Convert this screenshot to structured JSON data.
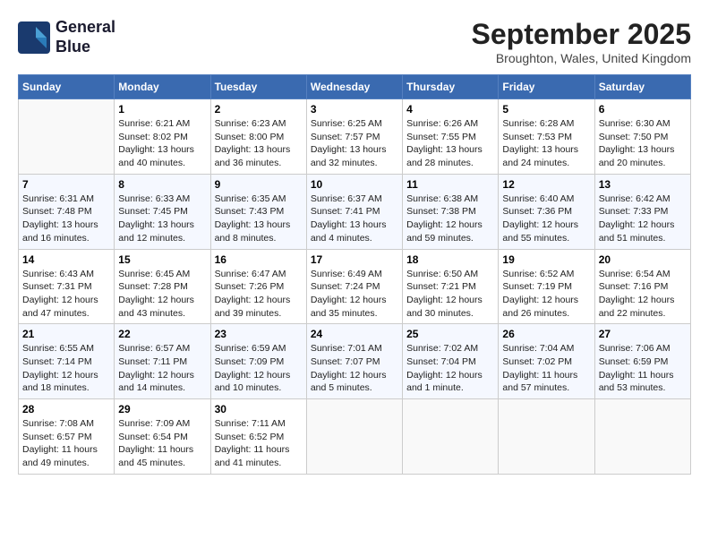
{
  "header": {
    "logo_line1": "General",
    "logo_line2": "Blue",
    "month_year": "September 2025",
    "location": "Broughton, Wales, United Kingdom"
  },
  "weekdays": [
    "Sunday",
    "Monday",
    "Tuesday",
    "Wednesday",
    "Thursday",
    "Friday",
    "Saturday"
  ],
  "weeks": [
    [
      {
        "day": "",
        "info": ""
      },
      {
        "day": "1",
        "info": "Sunrise: 6:21 AM\nSunset: 8:02 PM\nDaylight: 13 hours\nand 40 minutes."
      },
      {
        "day": "2",
        "info": "Sunrise: 6:23 AM\nSunset: 8:00 PM\nDaylight: 13 hours\nand 36 minutes."
      },
      {
        "day": "3",
        "info": "Sunrise: 6:25 AM\nSunset: 7:57 PM\nDaylight: 13 hours\nand 32 minutes."
      },
      {
        "day": "4",
        "info": "Sunrise: 6:26 AM\nSunset: 7:55 PM\nDaylight: 13 hours\nand 28 minutes."
      },
      {
        "day": "5",
        "info": "Sunrise: 6:28 AM\nSunset: 7:53 PM\nDaylight: 13 hours\nand 24 minutes."
      },
      {
        "day": "6",
        "info": "Sunrise: 6:30 AM\nSunset: 7:50 PM\nDaylight: 13 hours\nand 20 minutes."
      }
    ],
    [
      {
        "day": "7",
        "info": "Sunrise: 6:31 AM\nSunset: 7:48 PM\nDaylight: 13 hours\nand 16 minutes."
      },
      {
        "day": "8",
        "info": "Sunrise: 6:33 AM\nSunset: 7:45 PM\nDaylight: 13 hours\nand 12 minutes."
      },
      {
        "day": "9",
        "info": "Sunrise: 6:35 AM\nSunset: 7:43 PM\nDaylight: 13 hours\nand 8 minutes."
      },
      {
        "day": "10",
        "info": "Sunrise: 6:37 AM\nSunset: 7:41 PM\nDaylight: 13 hours\nand 4 minutes."
      },
      {
        "day": "11",
        "info": "Sunrise: 6:38 AM\nSunset: 7:38 PM\nDaylight: 12 hours\nand 59 minutes."
      },
      {
        "day": "12",
        "info": "Sunrise: 6:40 AM\nSunset: 7:36 PM\nDaylight: 12 hours\nand 55 minutes."
      },
      {
        "day": "13",
        "info": "Sunrise: 6:42 AM\nSunset: 7:33 PM\nDaylight: 12 hours\nand 51 minutes."
      }
    ],
    [
      {
        "day": "14",
        "info": "Sunrise: 6:43 AM\nSunset: 7:31 PM\nDaylight: 12 hours\nand 47 minutes."
      },
      {
        "day": "15",
        "info": "Sunrise: 6:45 AM\nSunset: 7:28 PM\nDaylight: 12 hours\nand 43 minutes."
      },
      {
        "day": "16",
        "info": "Sunrise: 6:47 AM\nSunset: 7:26 PM\nDaylight: 12 hours\nand 39 minutes."
      },
      {
        "day": "17",
        "info": "Sunrise: 6:49 AM\nSunset: 7:24 PM\nDaylight: 12 hours\nand 35 minutes."
      },
      {
        "day": "18",
        "info": "Sunrise: 6:50 AM\nSunset: 7:21 PM\nDaylight: 12 hours\nand 30 minutes."
      },
      {
        "day": "19",
        "info": "Sunrise: 6:52 AM\nSunset: 7:19 PM\nDaylight: 12 hours\nand 26 minutes."
      },
      {
        "day": "20",
        "info": "Sunrise: 6:54 AM\nSunset: 7:16 PM\nDaylight: 12 hours\nand 22 minutes."
      }
    ],
    [
      {
        "day": "21",
        "info": "Sunrise: 6:55 AM\nSunset: 7:14 PM\nDaylight: 12 hours\nand 18 minutes."
      },
      {
        "day": "22",
        "info": "Sunrise: 6:57 AM\nSunset: 7:11 PM\nDaylight: 12 hours\nand 14 minutes."
      },
      {
        "day": "23",
        "info": "Sunrise: 6:59 AM\nSunset: 7:09 PM\nDaylight: 12 hours\nand 10 minutes."
      },
      {
        "day": "24",
        "info": "Sunrise: 7:01 AM\nSunset: 7:07 PM\nDaylight: 12 hours\nand 5 minutes."
      },
      {
        "day": "25",
        "info": "Sunrise: 7:02 AM\nSunset: 7:04 PM\nDaylight: 12 hours\nand 1 minute."
      },
      {
        "day": "26",
        "info": "Sunrise: 7:04 AM\nSunset: 7:02 PM\nDaylight: 11 hours\nand 57 minutes."
      },
      {
        "day": "27",
        "info": "Sunrise: 7:06 AM\nSunset: 6:59 PM\nDaylight: 11 hours\nand 53 minutes."
      }
    ],
    [
      {
        "day": "28",
        "info": "Sunrise: 7:08 AM\nSunset: 6:57 PM\nDaylight: 11 hours\nand 49 minutes."
      },
      {
        "day": "29",
        "info": "Sunrise: 7:09 AM\nSunset: 6:54 PM\nDaylight: 11 hours\nand 45 minutes."
      },
      {
        "day": "30",
        "info": "Sunrise: 7:11 AM\nSunset: 6:52 PM\nDaylight: 11 hours\nand 41 minutes."
      },
      {
        "day": "",
        "info": ""
      },
      {
        "day": "",
        "info": ""
      },
      {
        "day": "",
        "info": ""
      },
      {
        "day": "",
        "info": ""
      }
    ]
  ]
}
